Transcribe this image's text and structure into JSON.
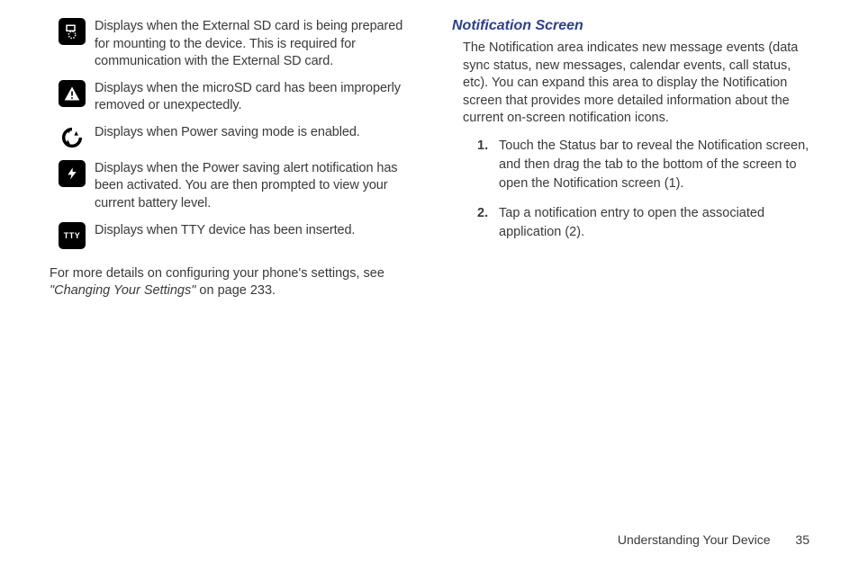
{
  "left": {
    "icons": [
      {
        "name": "sd-prepare-icon",
        "desc": "Displays when the External SD card is being prepared for mounting to the device. This is required for communication with the External SD card."
      },
      {
        "name": "sd-warning-icon",
        "desc": "Displays when the microSD card has been improperly removed or unexpectedly."
      },
      {
        "name": "recycle-icon",
        "desc": "Displays when Power saving mode is enabled."
      },
      {
        "name": "power-alert-icon",
        "desc": "Displays when the Power saving alert notification has been activated. You are then prompted to view your current battery level."
      },
      {
        "name": "tty-icon",
        "desc": "Displays when TTY device has been inserted."
      }
    ],
    "footnote_pre": "For more details on configuring your phone's settings, see ",
    "footnote_link": "\"Changing Your Settings\"",
    "footnote_post": " on page 233."
  },
  "right": {
    "heading": "Notification Screen",
    "body": "The Notification area indicates new message events (data sync status, new messages, calendar events, call status, etc). You can expand this area to display the Notification screen that provides more detailed information about the current on-screen notification icons.",
    "steps": [
      "Touch the Status bar to reveal the Notification screen, and then drag the tab to the bottom of the screen to open the Notification screen (1).",
      "Tap a notification entry to open the associated application (2)."
    ]
  },
  "footer": {
    "section": "Understanding Your Device",
    "page": "35"
  }
}
